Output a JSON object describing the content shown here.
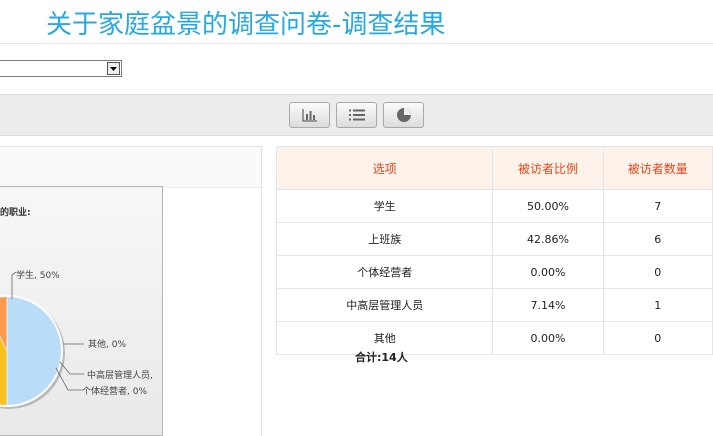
{
  "page": {
    "title": "关于家庭盆景的调查问卷-调查结果"
  },
  "toolbar": {
    "buttons": [
      {
        "name": "bar-chart",
        "icon": "bar-chart-icon"
      },
      {
        "name": "list",
        "icon": "list-icon"
      },
      {
        "name": "pie-chart",
        "icon": "pie-chart-icon"
      }
    ]
  },
  "chart": {
    "question": "的职业:",
    "labels": {
      "student": "学生, 50%",
      "other": "其他, 0%",
      "manager": "中高层管理人员,",
      "self_employed": "个体经营者, 0%"
    }
  },
  "table": {
    "headers": [
      "选项",
      "被访者比例",
      "被访者数量"
    ],
    "rows": [
      {
        "option": "学生",
        "ratio": "50.00%",
        "count": "7"
      },
      {
        "option": "上班族",
        "ratio": "42.86%",
        "count": "6"
      },
      {
        "option": "个体经营者",
        "ratio": "0.00%",
        "count": "0"
      },
      {
        "option": "中高层管理人员",
        "ratio": "7.14%",
        "count": "1"
      },
      {
        "option": "其他",
        "ratio": "0.00%",
        "count": "0"
      }
    ],
    "total": "合计:14人"
  },
  "chart_data": {
    "type": "pie",
    "categories": [
      "学生",
      "上班族",
      "个体经营者",
      "中高层管理人员",
      "其他"
    ],
    "values": [
      50.0,
      42.86,
      0.0,
      7.14,
      0.0
    ],
    "colors": [
      "#b9dcf9",
      "#f8c021",
      "#7fc242",
      "#ff9a4f",
      "#9d8bd2"
    ],
    "legend": "none"
  }
}
